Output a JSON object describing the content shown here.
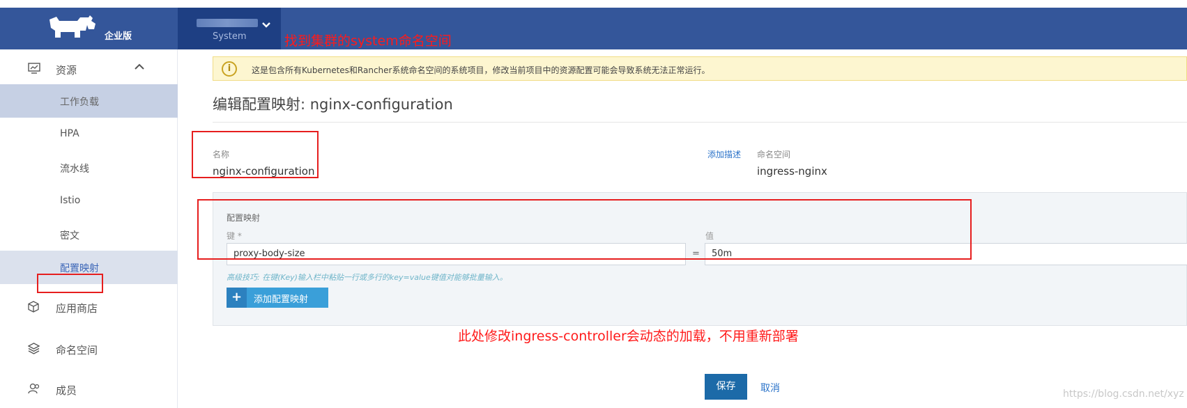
{
  "topbar": {
    "logo_text": "企业版",
    "project_label": "System"
  },
  "annotations": {
    "top": "找到集群的system命名空间",
    "middle": "此处修改ingress-controller会动态的加载，不用重新部署"
  },
  "sidebar": {
    "resources_label": "资源",
    "sub_items": [
      "工作负载",
      "HPA",
      "流水线",
      "Istio",
      "密文",
      "配置映射"
    ],
    "app_store_label": "应用商店",
    "namespaces_label": "命名空间",
    "members_label": "成员"
  },
  "banner": {
    "text": "这是包含所有Kubernetes和Rancher系统命名空间的系统项目，修改当前项目中的资源配置可能会导致系统无法正常运行。"
  },
  "page_title": "编辑配置映射: nginx-configuration",
  "form": {
    "name_label": "名称",
    "name_value": "nginx-configuration",
    "add_description": "添加描述",
    "namespace_label": "命名空间",
    "namespace_value": "ingress-nginx"
  },
  "configmap": {
    "title": "配置映射",
    "key_label": "键 *",
    "value_label": "值",
    "key_value": "proxy-body-size",
    "value_value": "50m",
    "equals": "=",
    "tip": "高级技巧: 在键(Key)输入栏中粘贴一行或多行的key=value键值对能够批量输入。",
    "add_button": "添加配置映射"
  },
  "actions": {
    "save": "保存",
    "cancel": "取消"
  },
  "watermark": "https://blog.csdn.net/xyz",
  "colors": {
    "topbar": "#34569a",
    "annotation": "#ff1a1a",
    "primary_button": "#1c6aa8",
    "add_button": "#3a9fd9"
  }
}
